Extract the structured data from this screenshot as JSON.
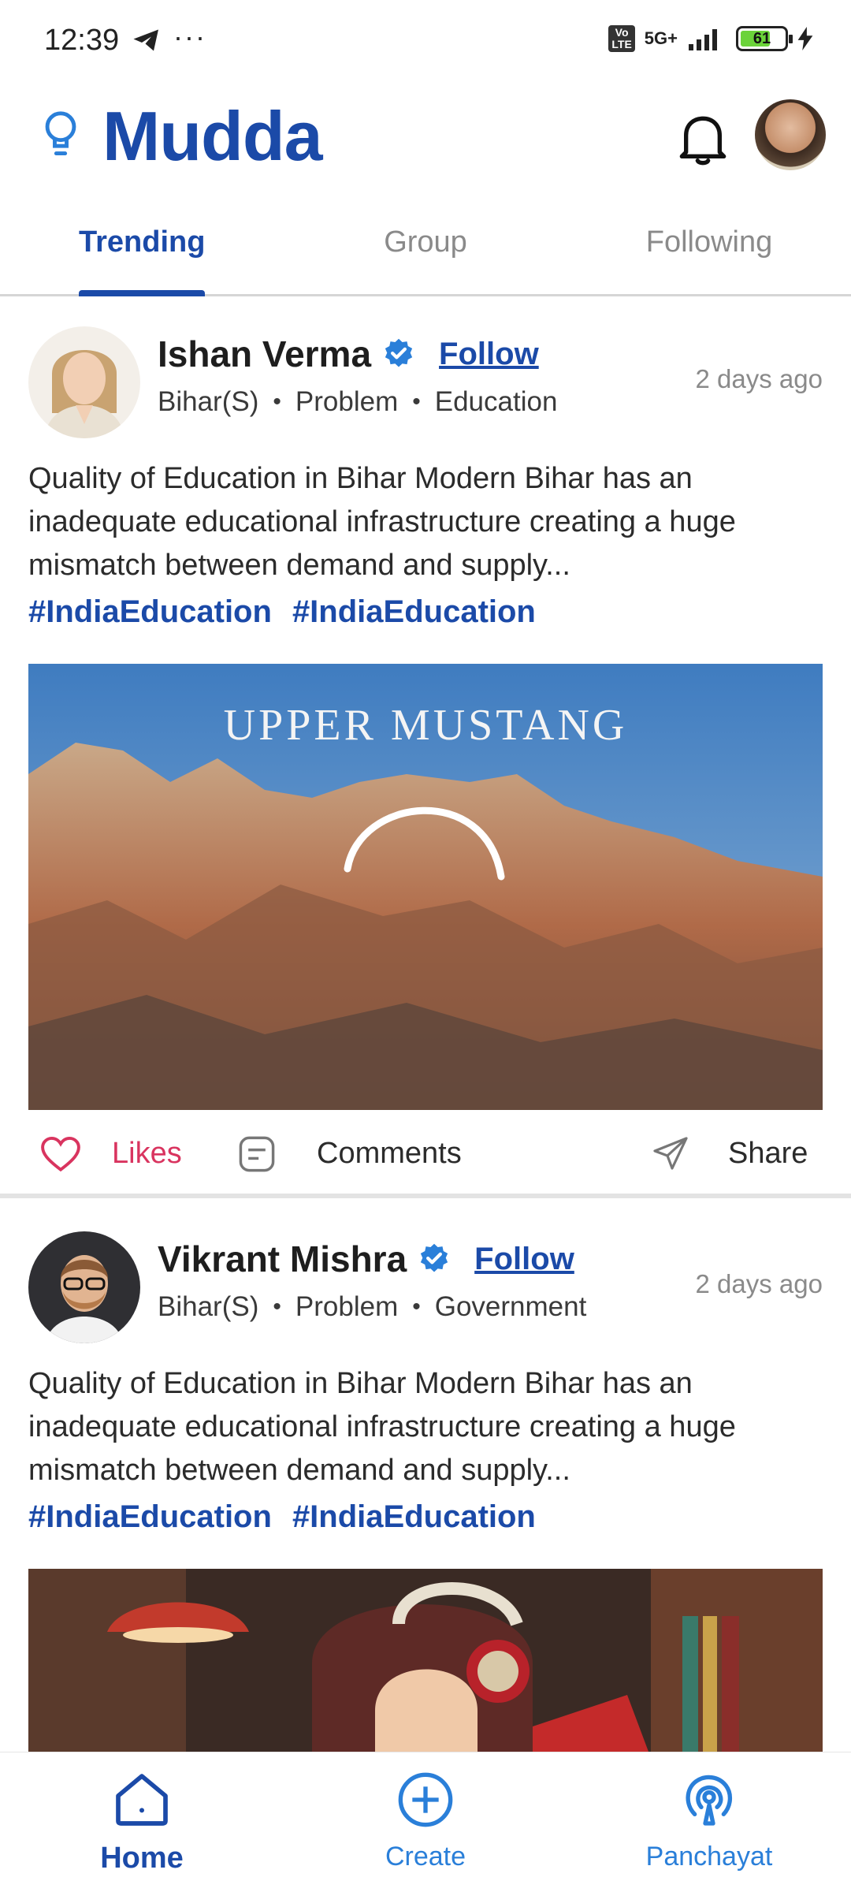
{
  "status_bar": {
    "time": "12:39",
    "network": "5G+",
    "battery": "61"
  },
  "header": {
    "title": "Mudda"
  },
  "tabs": [
    {
      "label": "Trending",
      "active": true
    },
    {
      "label": "Group",
      "active": false
    },
    {
      "label": "Following",
      "active": false
    }
  ],
  "posts": [
    {
      "author": "Ishan Verma",
      "follow_label": "Follow",
      "time": "2 days ago",
      "meta": [
        "Bihar(S)",
        "Problem",
        "Education"
      ],
      "text": "Quality of Education in Bihar Modern Bihar has an inadequate educational infrastructure creating a huge mismatch between demand and supply...",
      "tags": [
        "#IndiaEducation",
        "#IndiaEducation"
      ],
      "media_caption": "UPPER MUSTANG",
      "actions": {
        "likes": "Likes",
        "comments": "Comments",
        "share": "Share"
      }
    },
    {
      "author": "Vikrant Mishra",
      "follow_label": "Follow",
      "time": "2 days ago",
      "meta": [
        "Bihar(S)",
        "Problem",
        "Government"
      ],
      "text": "Quality of Education in Bihar Modern Bihar has an inadequate educational infrastructure creating a huge mismatch between demand and supply...",
      "tags": [
        "#IndiaEducation",
        "#IndiaEducation"
      ]
    }
  ],
  "bottom_nav": [
    {
      "label": "Home",
      "icon": "home-icon",
      "active": true
    },
    {
      "label": "Create",
      "icon": "plus-circle-icon",
      "active": false
    },
    {
      "label": "Panchayat",
      "icon": "broadcast-icon",
      "active": false
    }
  ],
  "colors": {
    "brand": "#1b4aa8",
    "accent": "#2a7fd9",
    "like": "#d9345f"
  }
}
